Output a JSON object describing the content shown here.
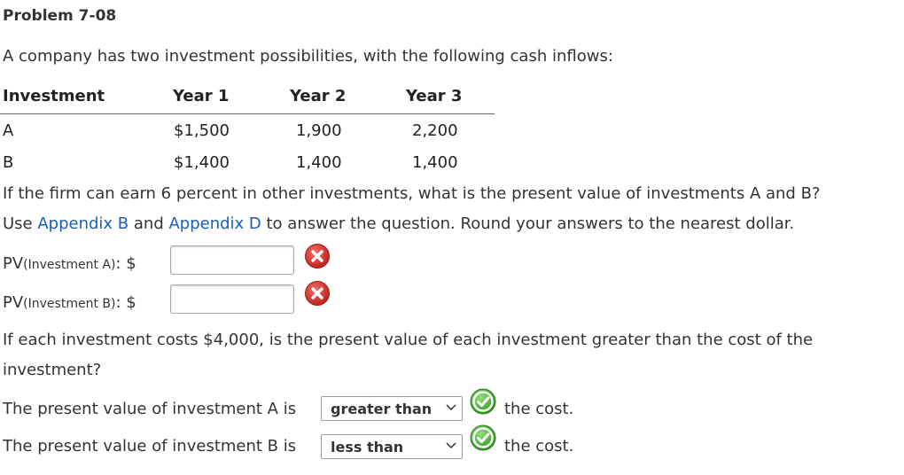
{
  "problem": {
    "title": "Problem 7-08",
    "intro": "A company has two investment possibilities, with the following cash inflows:"
  },
  "table": {
    "headers": [
      "Investment",
      "Year 1",
      "Year 2",
      "Year 3"
    ],
    "rows": [
      [
        "A",
        "$1,500",
        "1,900",
        "2,200"
      ],
      [
        "B",
        "$1,400",
        "1,400",
        "1,400"
      ]
    ]
  },
  "question1": {
    "text": "If the firm can earn 6 percent in other investments, what is the present value of investments A and B?",
    "use_prefix": "Use ",
    "link_b": "Appendix B",
    "and": " and ",
    "link_d": "Appendix D",
    "suffix": " to answer the question. Round your answers to the nearest dollar."
  },
  "pv_a": {
    "label_pre": "PV",
    "label_sub": "(Investment A)",
    "label_post": ": $",
    "value": "",
    "status_icon": "incorrect-x-icon"
  },
  "pv_b": {
    "label_pre": "PV",
    "label_sub": "(Investment B)",
    "label_post": ": $",
    "value": "",
    "status_icon": "incorrect-x-icon"
  },
  "question2": {
    "line1": "If each investment costs $4,000, is the present value of each investment greater than the cost of the",
    "line2": "investment?"
  },
  "answer_a": {
    "prefix": "The present value of investment A is",
    "selected": "greater than",
    "suffix": "the cost.",
    "status_icon": "correct-check-icon"
  },
  "answer_b": {
    "prefix": "The present value of investment B is",
    "selected": "less than",
    "suffix": "the cost.",
    "status_icon": "correct-check-icon"
  },
  "colors": {
    "link": "#1a5fb4",
    "incorrect": "#d32f2f",
    "correct": "#2e9e2e"
  }
}
